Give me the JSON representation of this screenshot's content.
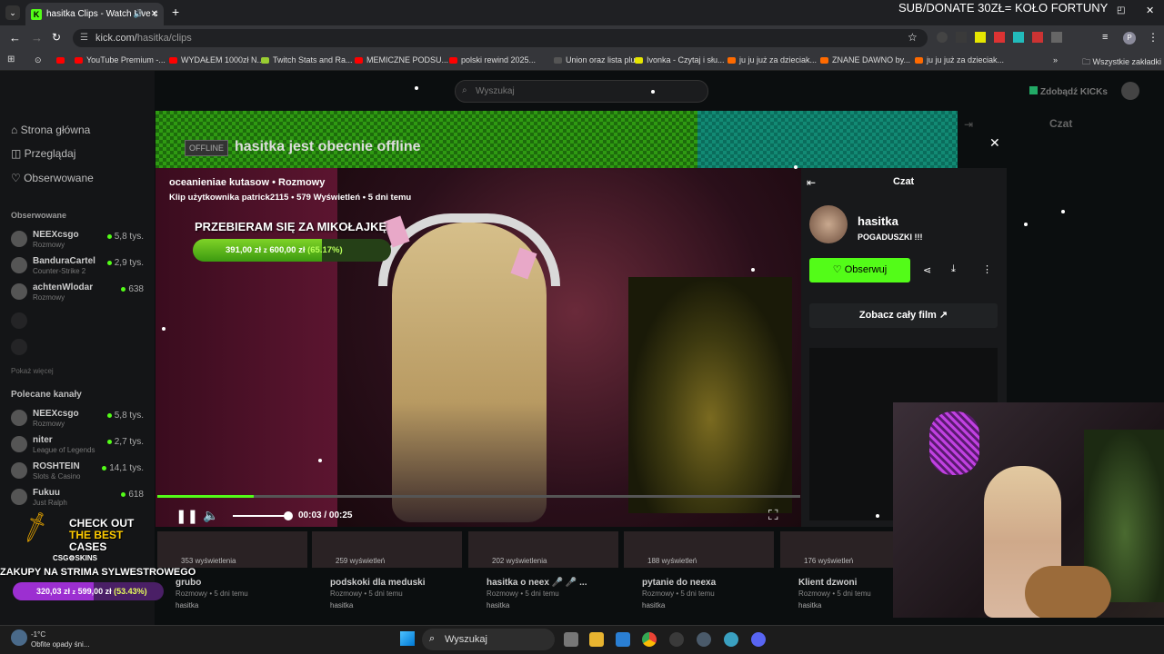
{
  "browser": {
    "tab_title": "hasitka Clips - Watch Live c",
    "url_host": "kick.com/",
    "url_path": "hasitka/clips",
    "overlay_text": "SUB/DONATE 30ZŁ= KOŁO FORTUNY",
    "bookmarks": [
      {
        "label": "YouTube Premium -...",
        "color": "#ff0000"
      },
      {
        "label": "WYDAŁEM 1000zł N...",
        "color": "#ff0000"
      },
      {
        "label": "Twitch Stats and Ra...",
        "color": "#9acd32"
      },
      {
        "label": "MEMICZNE PODSU...",
        "color": "#ff0000"
      },
      {
        "label": "polski rewind 2025...",
        "color": "#ff0000"
      },
      {
        "label": "Union oraz lista plu...",
        "color": "#555555"
      },
      {
        "label": "Ivonka - Czytaj i słu...",
        "color": "#e6e600"
      },
      {
        "label": "ju ju już za dzieciak...",
        "color": "#ff6a00"
      },
      {
        "label": "ZNANE DAWNO by...",
        "color": "#ff6a00"
      },
      {
        "label": "ju ju już za dzieciak...",
        "color": "#ff6a00"
      }
    ],
    "all_bookmarks": "Wszystkie zakładki"
  },
  "kick": {
    "search_placeholder": "Wyszukaj",
    "get_kicks": "Zdobądź KICKs",
    "chat_header": "Czat",
    "nav": [
      "Strona główna",
      "Przeglądaj",
      "Obserwowane"
    ],
    "followed_title": "Obserwowane",
    "show_more": "Pokaż więcej",
    "recommended_title": "Polecane kanały",
    "followed": [
      {
        "name": "NEEXcsgo",
        "cat": "Rozmowy",
        "viewers": "5,8 tys."
      },
      {
        "name": "BanduraCartel",
        "cat": "Counter-Strike 2",
        "viewers": "2,9 tys."
      },
      {
        "name": "achtenWlodar",
        "cat": "Rozmowy",
        "viewers": "638"
      }
    ],
    "recommended": [
      {
        "name": "NEEXcsgo",
        "cat": "Rozmowy",
        "viewers": "5,8 tys."
      },
      {
        "name": "niter",
        "cat": "League of Legends",
        "viewers": "2,7 tys."
      },
      {
        "name": "ROSHTEIN",
        "cat": "Slots & Casino",
        "viewers": "14,1 tys."
      },
      {
        "name": "Fukuu",
        "cat": "Just Ralph",
        "viewers": "618"
      }
    ],
    "offline_badge": "OFFLINE",
    "offline_msg": "hasitka jest obecnie offline"
  },
  "clip": {
    "title": "oceanieniae kutasow • Rozmowy",
    "subtitle": "Klip użytkownika patrick2115 • 579 Wyświetleń • 5 dni temu",
    "goal_title": "PRZEBIERAM SIĘ ZA MIKOŁAJKĘ",
    "goal_amount": "391,00 zł",
    "goal_of": "z",
    "goal_total": "600,00 zł",
    "goal_pct": "(65.17%)",
    "goal_fraction": 0.6517,
    "time": "00:03 / 00:25",
    "progress": 0.15,
    "volume": 0.9
  },
  "chat_panel": {
    "title": "Czat",
    "channel": "hasitka",
    "stream_title": "POGADUSZKI !!!",
    "follow": "Obserwuj",
    "full_film": "Zobacz cały film"
  },
  "cards": [
    {
      "views": "353 wyświetlenia",
      "title": "grubo",
      "cat": "Rozmowy",
      "age": "5 dni temu",
      "user": "hasitka"
    },
    {
      "views": "259 wyświetleń",
      "title": "podskoki dla meduski",
      "cat": "Rozmowy",
      "age": "5 dni temu",
      "user": "hasitka"
    },
    {
      "views": "202 wyświetlenia",
      "title": "hasitka o neex 🎤 🎤 ...",
      "cat": "Rozmowy",
      "age": "5 dni temu",
      "user": "hasitka"
    },
    {
      "views": "188 wyświetleń",
      "title": "pytanie do neexa",
      "cat": "Rozmowy",
      "age": "5 dni temu",
      "user": "hasitka"
    },
    {
      "views": "176 wyświetleń",
      "title": "Klient dzwoni",
      "cat": "Rozmowy",
      "age": "5 dni temu",
      "user": "hasitka"
    }
  ],
  "promo": {
    "line1": "CHECK OUT",
    "line2": "THE BEST",
    "line3": "CASES",
    "brand": "CSG⚙SKINS",
    "strima": "ZAKUPY NA STRIMA SYLWESTROWEGO",
    "goal_amount": "320,03 zł",
    "goal_of": "z",
    "goal_total": "599,00 zł",
    "goal_pct": "(53.43%)",
    "goal_fraction": 0.5343
  },
  "taskbar": {
    "temp": "-1°C",
    "weather": "Obfite opady śni...",
    "search": "Wyszukaj"
  }
}
